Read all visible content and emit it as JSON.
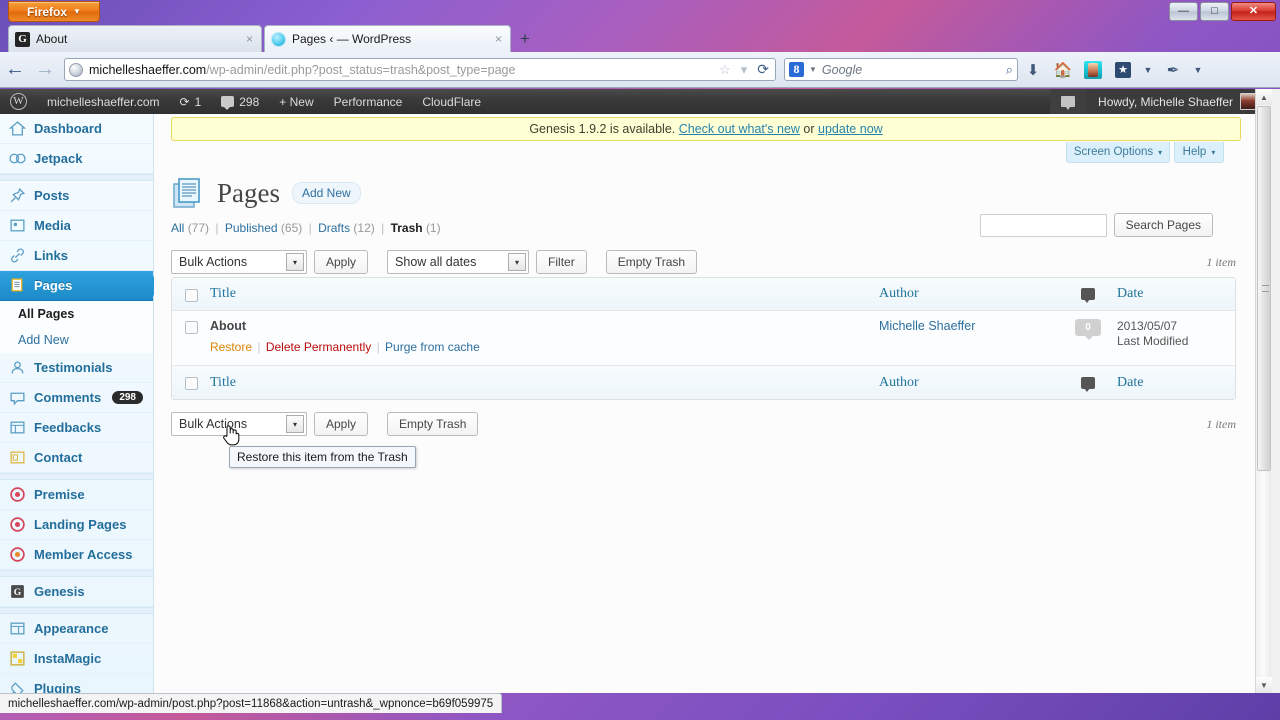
{
  "browser": {
    "firefox_button": "Firefox",
    "tabs": [
      {
        "title": "About",
        "favicon": "genesis-g-icon",
        "close": "×"
      },
      {
        "title": "Pages ‹ — WordPress",
        "favicon": "wordpress-bubble-icon",
        "close": "×"
      }
    ],
    "new_tab": "+",
    "window_controls": {
      "minimize": "—",
      "maximize": "□",
      "close": "✕"
    },
    "nav": {
      "back": "←",
      "forward": "→"
    },
    "url": {
      "domain": "michelleshaeffer.com",
      "path": "/wp-admin/edit.php?post_status=trash&post_type=page"
    },
    "url_icons": {
      "bookmark": "☆",
      "dropdown": "▾",
      "reload": "⟳"
    },
    "search": {
      "engine": "Google",
      "engine_logo": "8",
      "placeholder": "Google",
      "magnifier": "⌕"
    },
    "toolbar_icons": [
      "download-icon",
      "home-icon",
      "app-icon",
      "bookmarks-star-icon",
      "feather-icon",
      "overflow-chevron-icon"
    ],
    "statusbar_url": "michelleshaeffer.com/wp-admin/post.php?post=11868&action=untrash&_wpnonce=b69f059975"
  },
  "adminbar": {
    "logo": "wordpress-logo",
    "site": "michelleshaeffer.com",
    "updates_icon": "⟳",
    "updates_count": "1",
    "comments_count": "298",
    "new": "+ New",
    "performance": "Performance",
    "cloudflare": "CloudFlare",
    "howdy": "Howdy, Michelle Shaeffer"
  },
  "sidebar": {
    "items": [
      {
        "label": "Dashboard",
        "icon": "home-icon",
        "active": false
      },
      {
        "label": "Jetpack",
        "icon": "jetpack-icon",
        "active": false
      },
      {
        "label": "Posts",
        "icon": "pin-icon",
        "active": false
      },
      {
        "label": "Media",
        "icon": "media-icon",
        "active": false
      },
      {
        "label": "Links",
        "icon": "link-icon",
        "active": false
      },
      {
        "label": "Pages",
        "icon": "pages-icon",
        "active": true
      },
      {
        "label": "Testimonials",
        "icon": "user-icon",
        "active": false
      },
      {
        "label": "Comments",
        "icon": "comment-icon",
        "active": false,
        "badge": "298"
      },
      {
        "label": "Feedbacks",
        "icon": "feedback-icon",
        "active": false
      },
      {
        "label": "Contact",
        "icon": "contact-icon",
        "active": false
      },
      {
        "label": "Premise",
        "icon": "target-icon",
        "active": false
      },
      {
        "label": "Landing Pages",
        "icon": "target-icon",
        "active": false
      },
      {
        "label": "Member Access",
        "icon": "target-icon",
        "active": false
      },
      {
        "label": "Genesis",
        "icon": "genesis-g-icon",
        "active": false
      },
      {
        "label": "Appearance",
        "icon": "appearance-icon",
        "active": false
      },
      {
        "label": "InstaMagic",
        "icon": "instamagic-icon",
        "active": false
      },
      {
        "label": "Plugins",
        "icon": "plug-icon",
        "active": false
      }
    ],
    "submenu": [
      {
        "label": "All Pages",
        "current": true
      },
      {
        "label": "Add New",
        "current": false
      }
    ]
  },
  "notice": {
    "text_before": "Genesis 1.9.2 is available.",
    "link1": "Check out what's new",
    "middle": "or",
    "link2": "update now"
  },
  "screen_meta": {
    "screen_options": "Screen Options",
    "help": "Help",
    "caret": "▾"
  },
  "page": {
    "icon": "pages-icon",
    "title": "Pages",
    "add_new": "Add New",
    "views": [
      {
        "label": "All",
        "count": "(77)",
        "current": false
      },
      {
        "label": "Published",
        "count": "(65)",
        "current": false
      },
      {
        "label": "Drafts",
        "count": "(12)",
        "current": false
      },
      {
        "label": "Trash",
        "count": "(1)",
        "current": true
      }
    ],
    "search": {
      "value": "",
      "placeholder": "",
      "button": "Search Pages"
    }
  },
  "tablenav_top": {
    "bulk_actions": "Bulk Actions",
    "apply": "Apply",
    "dates": "Show all dates",
    "filter": "Filter",
    "empty_trash": "Empty Trash",
    "item_count": "1 item",
    "caret": "▾"
  },
  "tablenav_bottom": {
    "bulk_actions": "Bulk Actions",
    "apply": "Apply",
    "empty_trash": "Empty Trash",
    "item_count": "1 item",
    "caret": "▾"
  },
  "table": {
    "columns": {
      "title": "Title",
      "author": "Author",
      "comments": "comment-bubble-icon",
      "date": "Date"
    },
    "rows": [
      {
        "title": "About",
        "actions": {
          "restore": "Restore",
          "delete": "Delete Permanently",
          "purge": "Purge from cache"
        },
        "author": "Michelle Shaeffer",
        "comments": "0",
        "date": "2013/05/07",
        "date_label": "Last Modified"
      }
    ]
  },
  "tooltip": {
    "text": "Restore this item from the Trash"
  },
  "colors": {
    "wp_blue": "#2ea2dd",
    "link_blue": "#2d6f9e",
    "restore_orange": "#d98500",
    "delete_red": "#bc0b0b",
    "notice_yellow": "#ffffd5",
    "firefox_orange": "#ef7b18"
  }
}
